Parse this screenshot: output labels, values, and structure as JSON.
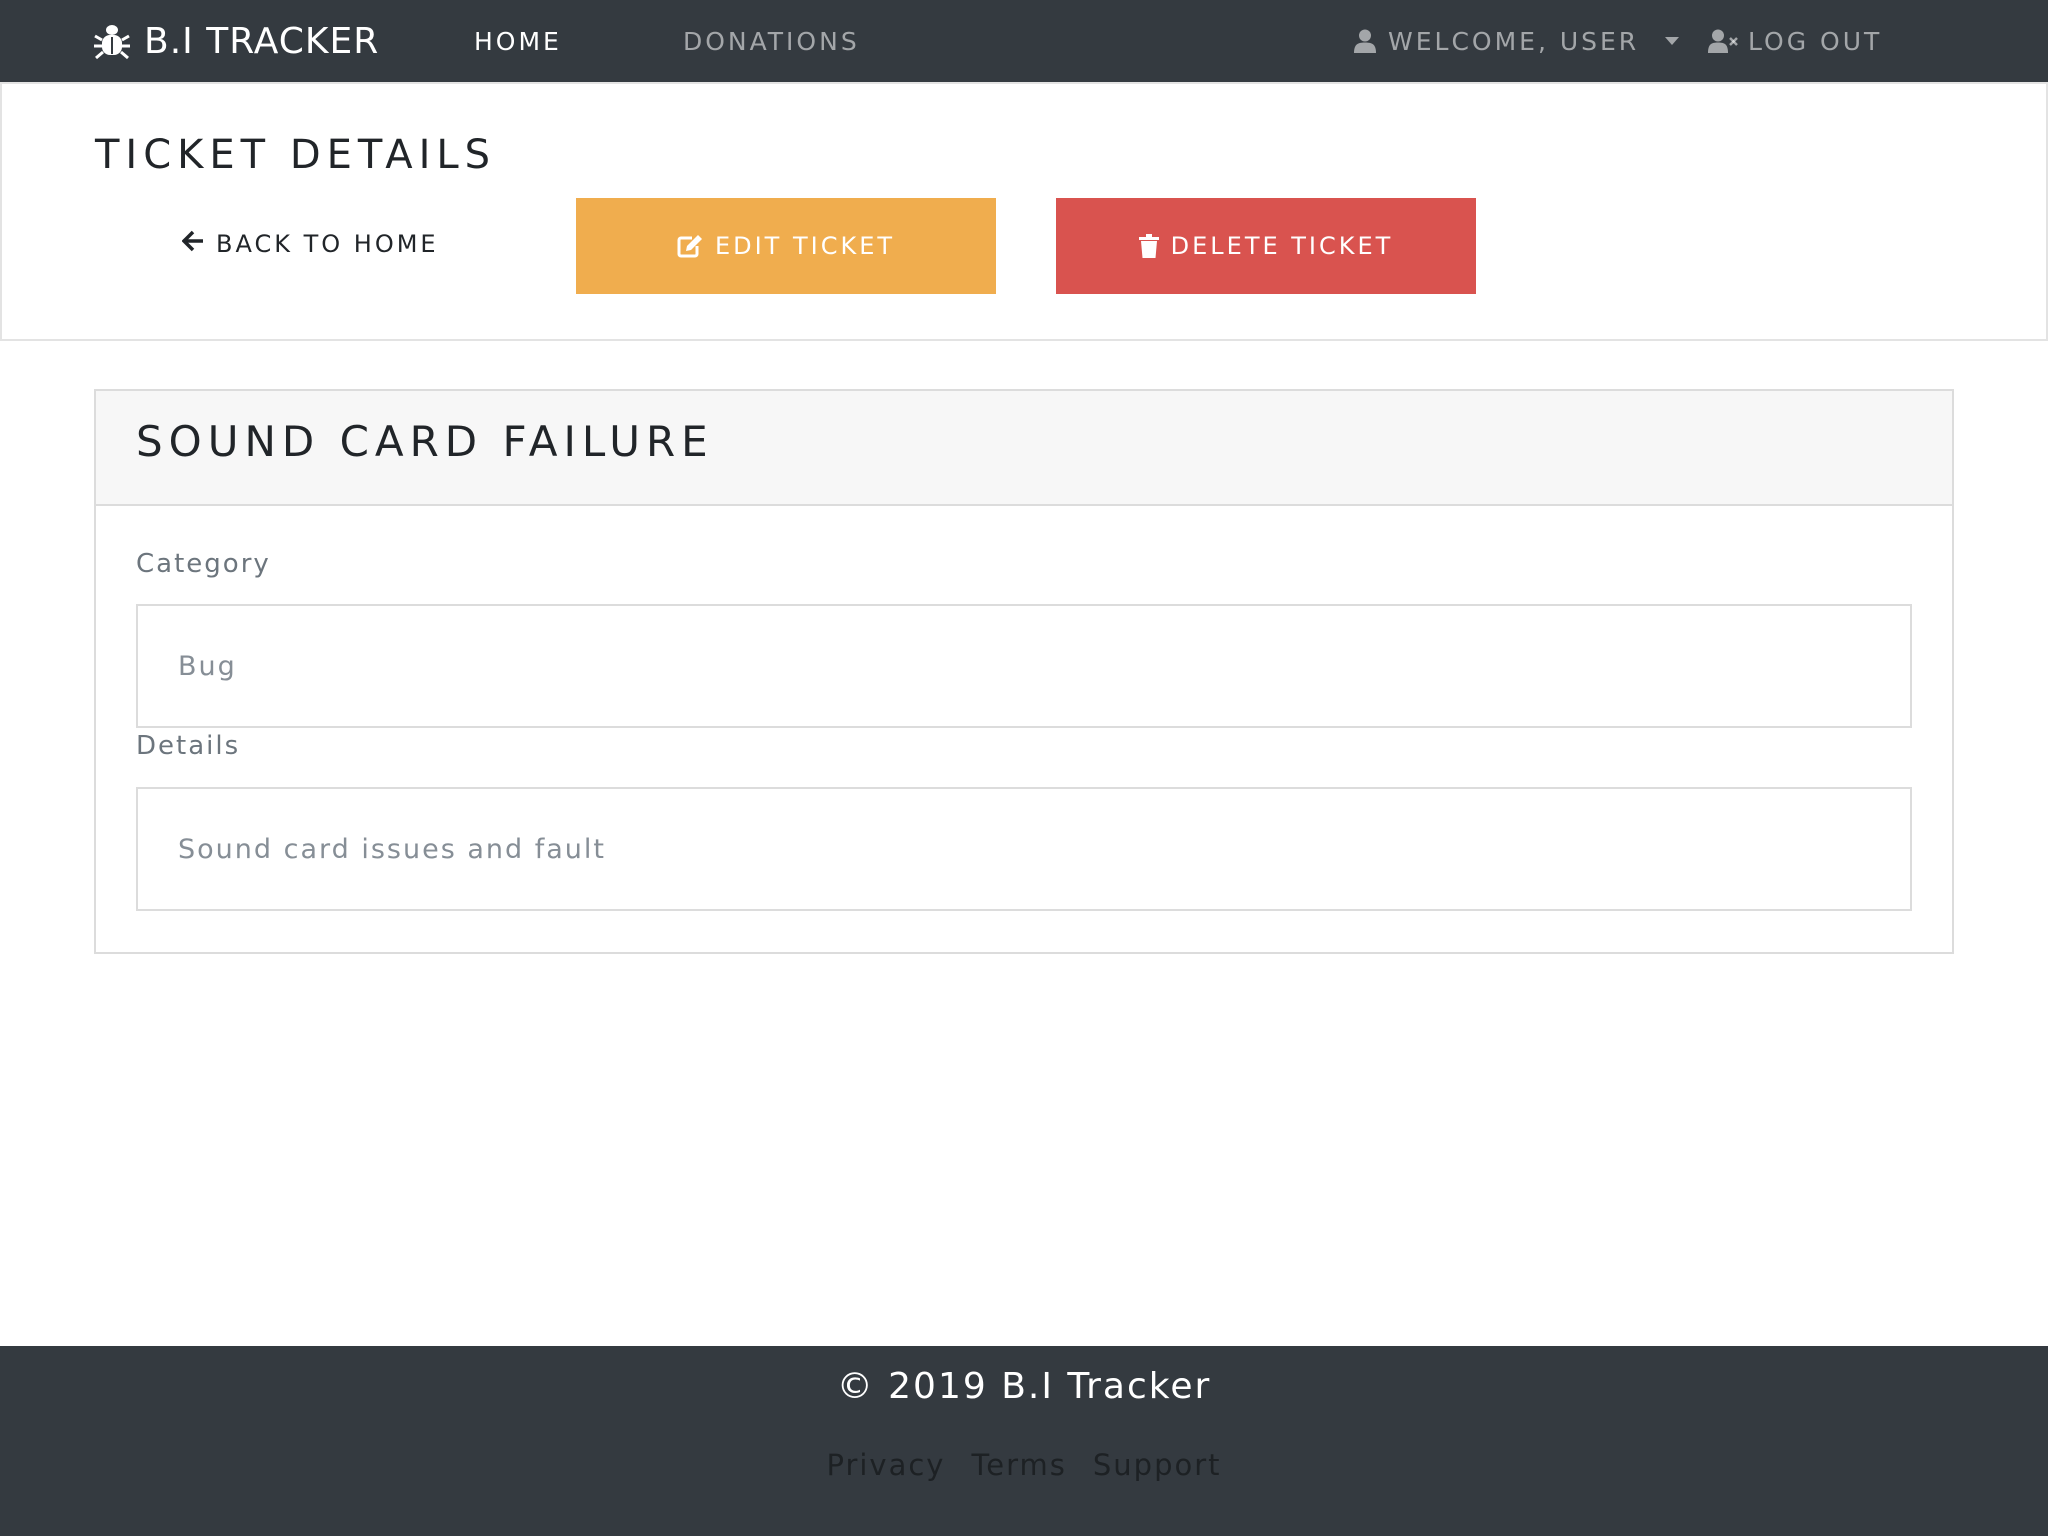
{
  "navbar": {
    "brand": "B.I TRACKER",
    "brand_icon": "bug-icon",
    "links": [
      {
        "label": "HOME",
        "active": true
      },
      {
        "label": "DONATIONS",
        "active": false
      }
    ],
    "user_menu": {
      "label": "WELCOME, USER",
      "icon": "user-icon"
    },
    "logout": {
      "label": "LOG OUT",
      "icon": "user-times-icon"
    }
  },
  "header": {
    "title": "TICKET DETAILS",
    "back_label": "BACK TO HOME",
    "edit_label": "EDIT TICKET",
    "delete_label": "DELETE TICKET"
  },
  "ticket": {
    "title": "SOUND CARD FAILURE",
    "category_label": "Category",
    "category_value": "Bug",
    "details_label": "Details",
    "details_value": "Sound card issues and fault"
  },
  "footer": {
    "copyright": "© 2019 B.I Tracker",
    "links": [
      "Privacy",
      "Terms",
      "Support"
    ]
  },
  "colors": {
    "navbar": "#343a40",
    "edit": "#f0ad4e",
    "delete": "#d9534f"
  }
}
